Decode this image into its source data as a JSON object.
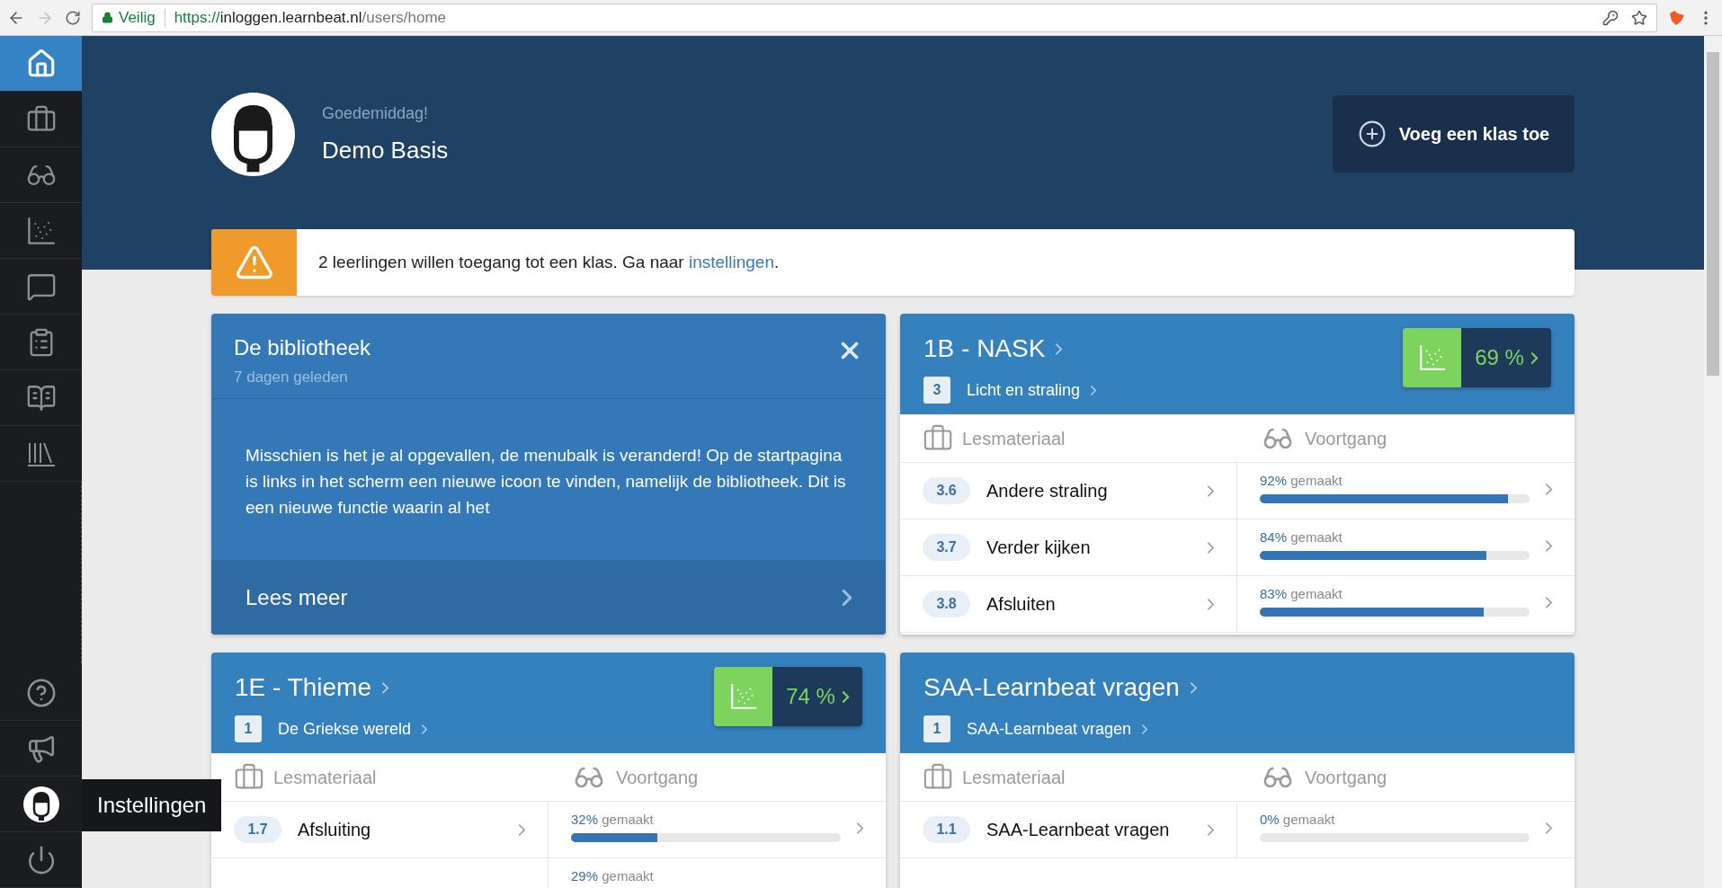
{
  "browser": {
    "security_label": "Veilig",
    "url": {
      "scheme": "https://",
      "host": "inloggen.learnbeat.nl",
      "path": "/users/home"
    }
  },
  "sidebar": {
    "top_items": [
      {
        "kind": "home",
        "selected": true
      },
      {
        "kind": "briefcase",
        "selected": false
      },
      {
        "kind": "glasses",
        "selected": false
      },
      {
        "kind": "chart",
        "selected": false
      },
      {
        "kind": "chat",
        "selected": false
      },
      {
        "kind": "notepad",
        "selected": false
      },
      {
        "kind": "books",
        "selected": false
      },
      {
        "kind": "library",
        "selected": false
      }
    ],
    "bottom_items": [
      {
        "kind": "help",
        "selected": false
      },
      {
        "kind": "megaphone",
        "selected": false
      },
      {
        "kind": "avatar",
        "selected": false,
        "tooltip": "Instellingen"
      },
      {
        "kind": "power",
        "selected": false
      }
    ]
  },
  "header": {
    "greeting": "Goedemiddag!",
    "name": "Demo Basis",
    "add_button": "Voeg een klas toe"
  },
  "alert": {
    "text_before": "2 leerlingen willen toegang tot een klas. Ga naar ",
    "link": "instellingen",
    "text_after": "."
  },
  "news_card": {
    "title": "De bibliotheek",
    "time": "7 dagen geleden",
    "body": "Misschien is het je al opgevallen, de menubalk is veranderd! Op de startpagina is links in het scherm een nieuwe icoon te vinden, namelijk de bibliotheek. Dit is een nieuwe functie waarin al het",
    "read_more": "Lees meer"
  },
  "class_cards": [
    {
      "title": "1B - NASK",
      "chapter_number": "3",
      "chapter": "Licht en straling",
      "score": "69 %",
      "columns": [
        "Lesmateriaal",
        "Voortgang"
      ],
      "rows": [
        {
          "number": "3.6",
          "title": "Andere straling",
          "percent": "92%",
          "done_label": "gemaakt",
          "level": 0.92
        },
        {
          "number": "3.7",
          "title": "Verder kijken",
          "percent": "84%",
          "done_label": "gemaakt",
          "level": 0.84
        },
        {
          "number": "3.8",
          "title": "Afsluiten",
          "percent": "83%",
          "done_label": "gemaakt",
          "level": 0.83
        }
      ]
    },
    {
      "title": "1E - Thieme",
      "chapter_number": "1",
      "chapter": "De Griekse wereld",
      "score": "74 %",
      "columns": [
        "Lesmateriaal",
        "Voortgang"
      ],
      "rows": [
        {
          "number": "1.7",
          "title": "Afsluiting",
          "percent": "32%",
          "done_label": "gemaakt",
          "level": 0.32
        },
        {
          "percent": "29%",
          "done_label": "gemaakt"
        }
      ]
    },
    {
      "title": "SAA-Learnbeat vragen",
      "chapter_number": "1",
      "chapter": "SAA-Learnbeat vragen",
      "columns": [
        "Lesmateriaal",
        "Voortgang"
      ],
      "rows": [
        {
          "number": "1.1",
          "title": "SAA-Learnbeat vragen",
          "percent": "0%",
          "done_label": "gemaakt",
          "kind": "empty-bar"
        }
      ]
    }
  ]
}
